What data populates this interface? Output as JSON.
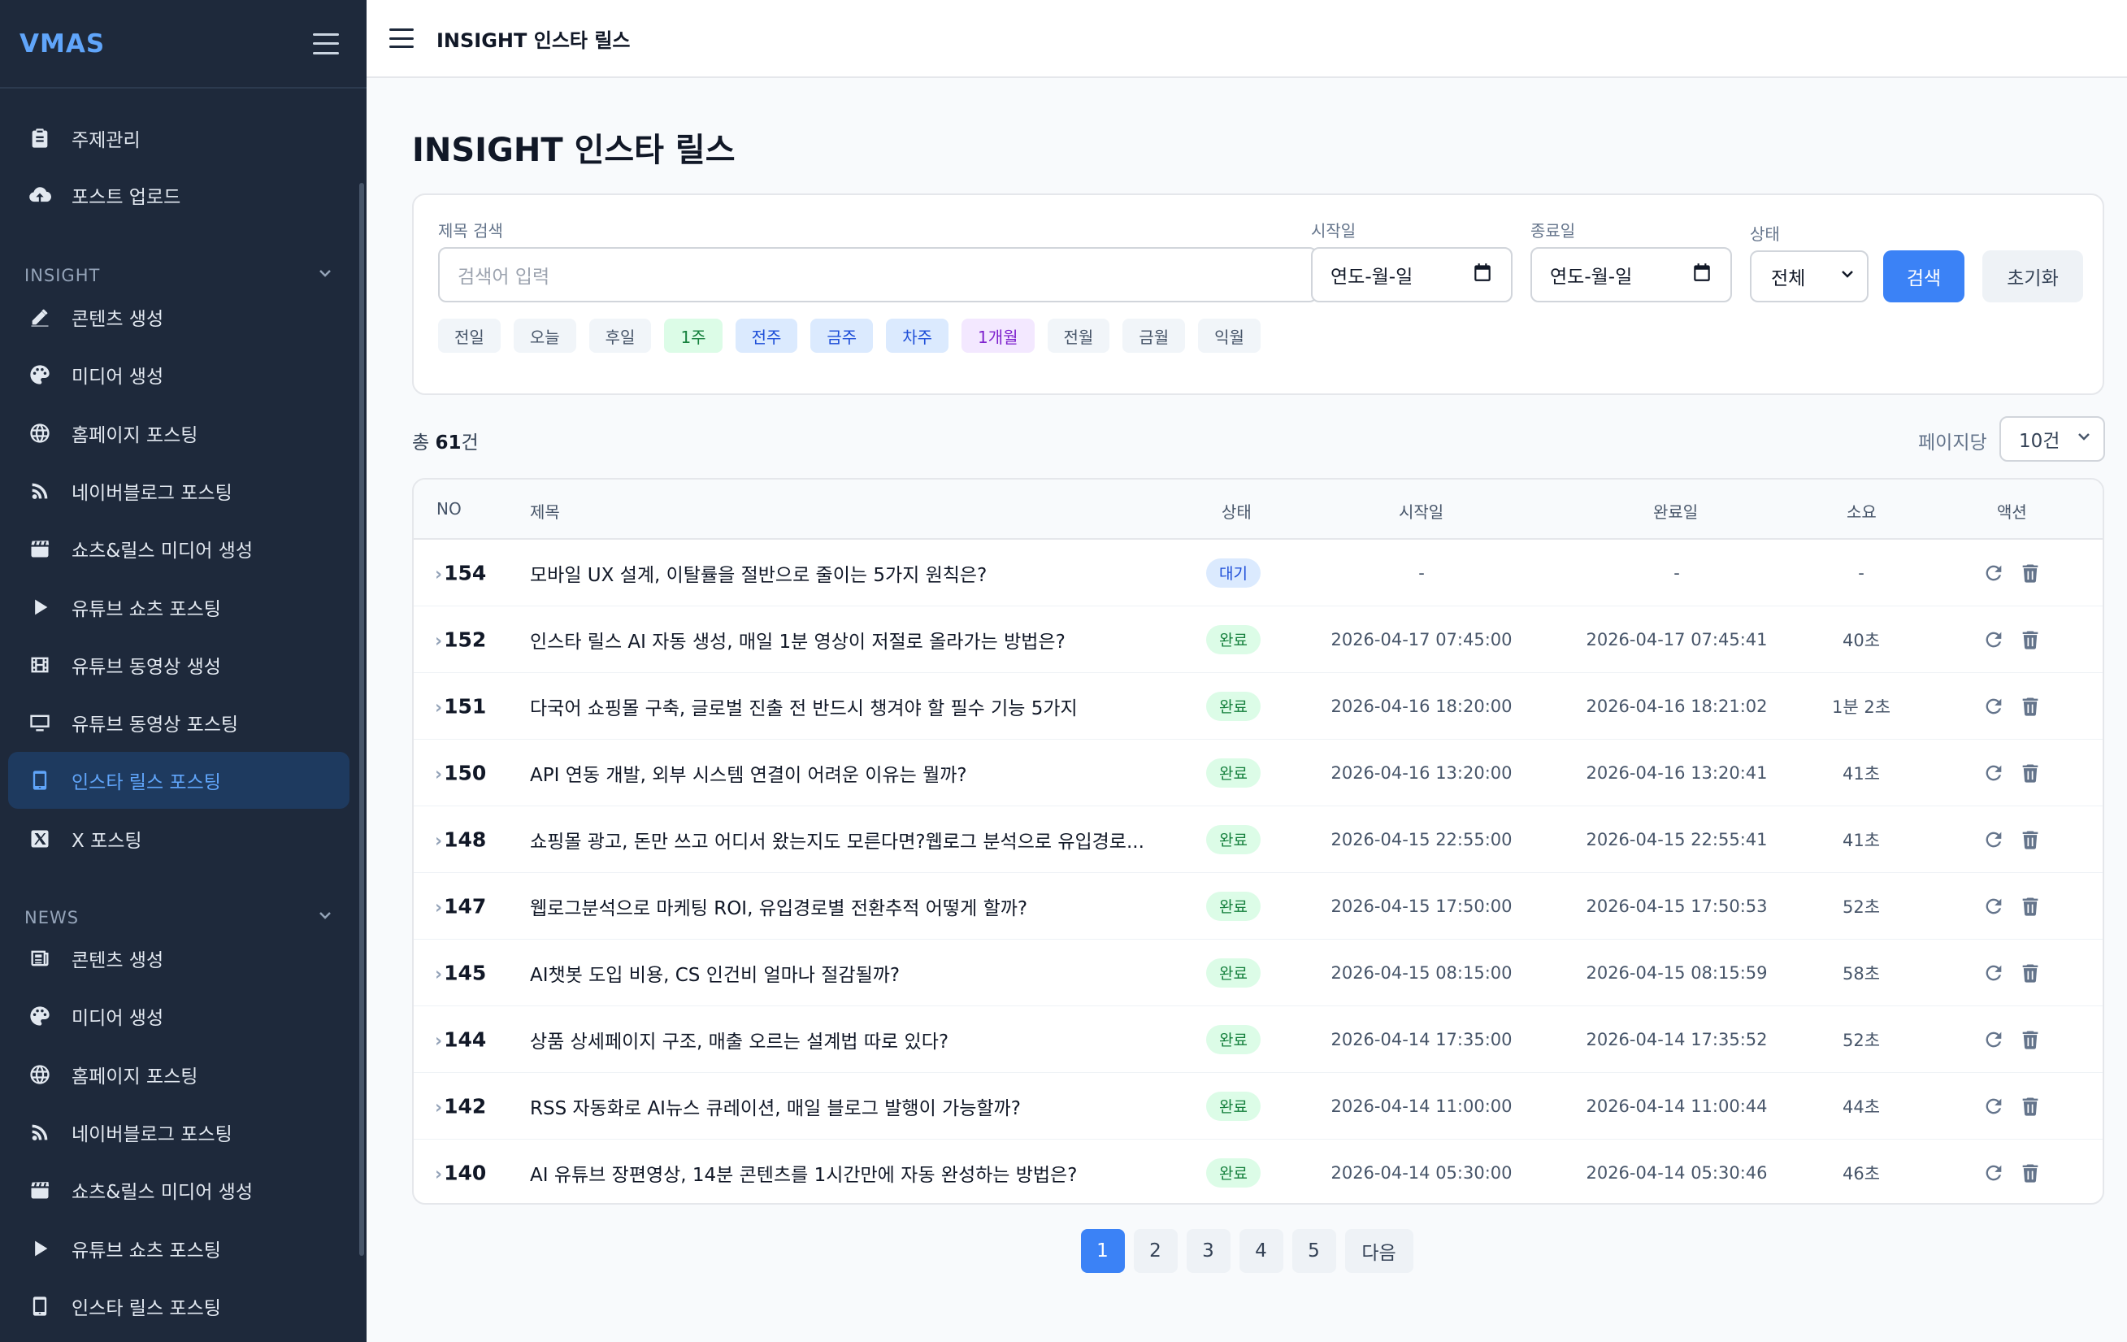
{
  "sidebar": {
    "brand": "VMAS",
    "top_items": [
      {
        "label": "주제관리",
        "icon": "clipboard-icon"
      },
      {
        "label": "포스트 업로드",
        "icon": "cloud-upload-icon"
      }
    ],
    "sections": [
      {
        "title": "INSIGHT",
        "items": [
          {
            "label": "콘텐츠 생성",
            "icon": "edit-icon"
          },
          {
            "label": "미디어 생성",
            "icon": "palette-icon"
          },
          {
            "label": "홈페이지 포스팅",
            "icon": "globe-icon"
          },
          {
            "label": "네이버블로그 포스팅",
            "icon": "blog-icon"
          },
          {
            "label": "쇼츠&릴스 미디어 생성",
            "icon": "clapperboard-icon"
          },
          {
            "label": "유튜브 쇼츠 포스팅",
            "icon": "play-icon"
          },
          {
            "label": "유튜브 동영상 생성",
            "icon": "film-icon"
          },
          {
            "label": "유튜브 동영상 포스팅",
            "icon": "monitor-icon"
          },
          {
            "label": "인스타 릴스 포스팅",
            "icon": "mobile-icon",
            "active": true
          },
          {
            "label": "X 포스팅",
            "icon": "x-icon"
          }
        ]
      },
      {
        "title": "NEWS",
        "items": [
          {
            "label": "콘텐츠 생성",
            "icon": "newspaper-icon"
          },
          {
            "label": "미디어 생성",
            "icon": "palette-icon"
          },
          {
            "label": "홈페이지 포스팅",
            "icon": "globe-icon"
          },
          {
            "label": "네이버블로그 포스팅",
            "icon": "blog-icon"
          },
          {
            "label": "쇼츠&릴스 미디어 생성",
            "icon": "clapperboard-icon"
          },
          {
            "label": "유튜브 쇼츠 포스팅",
            "icon": "play-icon"
          },
          {
            "label": "인스타 릴스 포스팅",
            "icon": "mobile-icon"
          }
        ]
      }
    ]
  },
  "topbar": {
    "title": "INSIGHT 인스타 릴스"
  },
  "page": {
    "title": "INSIGHT 인스타 릴스"
  },
  "filters": {
    "title_label": "제목 검색",
    "title_placeholder": "검색어 입력",
    "start_label": "시작일",
    "start_value": "연도-월-일",
    "end_label": "종료일",
    "end_value": "연도-월-일",
    "status_label": "상태",
    "status_value": "전체",
    "search_button": "검색",
    "reset_button": "초기화",
    "chips": [
      {
        "label": "전일",
        "tone": "gray"
      },
      {
        "label": "오늘",
        "tone": "gray"
      },
      {
        "label": "후일",
        "tone": "gray"
      },
      {
        "label": "1주",
        "tone": "green"
      },
      {
        "label": "전주",
        "tone": "blue"
      },
      {
        "label": "금주",
        "tone": "blue"
      },
      {
        "label": "차주",
        "tone": "blue"
      },
      {
        "label": "1개월",
        "tone": "purple"
      },
      {
        "label": "전월",
        "tone": "gray"
      },
      {
        "label": "금월",
        "tone": "gray"
      },
      {
        "label": "익월",
        "tone": "gray"
      }
    ]
  },
  "summary": {
    "prefix": "총 ",
    "count": "61",
    "suffix": "건",
    "per_page_label": "페이지당",
    "per_page_value": "10건"
  },
  "table": {
    "headers": {
      "no": "NO",
      "title": "제목",
      "status": "상태",
      "start": "시작일",
      "end": "완료일",
      "duration": "소요",
      "action": "액션"
    },
    "rows": [
      {
        "no": "154",
        "title": "모바일 UX 설계, 이탈률을 절반으로 줄이는 5가지 원칙은?",
        "status": "대기",
        "start": "-",
        "end": "-",
        "duration": "-"
      },
      {
        "no": "152",
        "title": "인스타 릴스 AI 자동 생성, 매일 1분 영상이 저절로 올라가는 방법은?",
        "status": "완료",
        "start": "2026-04-17 07:45:00",
        "end": "2026-04-17 07:45:41",
        "duration": "40초"
      },
      {
        "no": "151",
        "title": "다국어 쇼핑몰 구축, 글로벌 진출 전 반드시 챙겨야 할 필수 기능 5가지",
        "status": "완료",
        "start": "2026-04-16 18:20:00",
        "end": "2026-04-16 18:21:02",
        "duration": "1분 2초"
      },
      {
        "no": "150",
        "title": "API 연동 개발, 외부 시스템 연결이 어려운 이유는 뭘까?",
        "status": "완료",
        "start": "2026-04-16 13:20:00",
        "end": "2026-04-16 13:20:41",
        "duration": "41초"
      },
      {
        "no": "148",
        "title": "쇼핑몰 광고, 돈만 쓰고 어디서 왔는지도 모른다면?웹로그 분석으로 유입경로...",
        "status": "완료",
        "start": "2026-04-15 22:55:00",
        "end": "2026-04-15 22:55:41",
        "duration": "41초"
      },
      {
        "no": "147",
        "title": "웹로그분석으로 마케팅 ROI, 유입경로별 전환추적 어떻게 할까?",
        "status": "완료",
        "start": "2026-04-15 17:50:00",
        "end": "2026-04-15 17:50:53",
        "duration": "52초"
      },
      {
        "no": "145",
        "title": "AI챗봇 도입 비용, CS 인건비 얼마나 절감될까?",
        "status": "완료",
        "start": "2026-04-15 08:15:00",
        "end": "2026-04-15 08:15:59",
        "duration": "58초"
      },
      {
        "no": "144",
        "title": "상품 상세페이지 구조, 매출 오르는 설계법 따로 있다?",
        "status": "완료",
        "start": "2026-04-14 17:35:00",
        "end": "2026-04-14 17:35:52",
        "duration": "52초"
      },
      {
        "no": "142",
        "title": "RSS 자동화로 AI뉴스 큐레이션, 매일 블로그 발행이 가능할까?",
        "status": "완료",
        "start": "2026-04-14 11:00:00",
        "end": "2026-04-14 11:00:44",
        "duration": "44초"
      },
      {
        "no": "140",
        "title": "AI 유튜브 장편영상, 14분 콘텐츠를 1시간만에 자동 완성하는 방법은?",
        "status": "완료",
        "start": "2026-04-14 05:30:00",
        "end": "2026-04-14 05:30:46",
        "duration": "46초"
      }
    ]
  },
  "pagination": {
    "pages": [
      "1",
      "2",
      "3",
      "4",
      "5"
    ],
    "active": "1",
    "next": "다음"
  }
}
